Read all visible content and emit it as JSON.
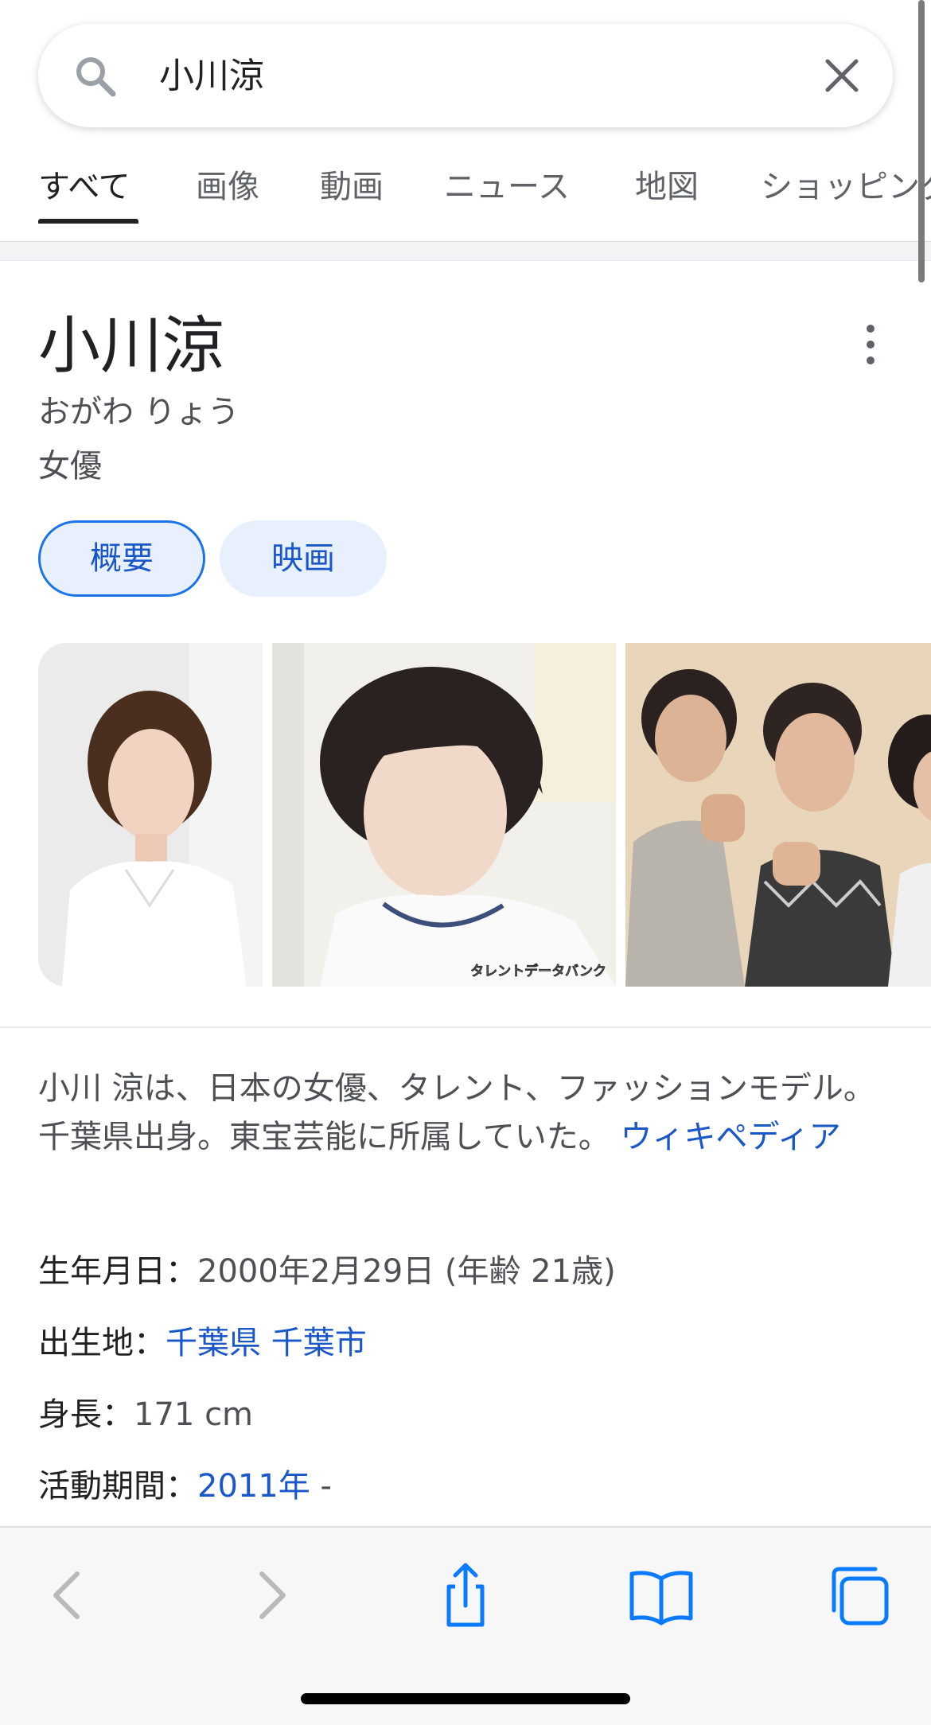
{
  "search": {
    "query": "小川涼"
  },
  "tabs": [
    {
      "label": "すべて"
    },
    {
      "label": "画像"
    },
    {
      "label": "動画"
    },
    {
      "label": "ニュース"
    },
    {
      "label": "地図"
    },
    {
      "label": "ショッピング"
    }
  ],
  "panel": {
    "title": "小川涼",
    "reading": "おがわ りょう",
    "type": "女優",
    "chips": [
      {
        "label": "概要"
      },
      {
        "label": "映画"
      }
    ],
    "image_watermark": "タレントデータバンク",
    "description": "小川 涼は、日本の女優、タレント、ファッションモデル。千葉県出身。東宝芸能に所属していた。",
    "source_link": "ウィキペディア",
    "facts": {
      "birth_label": "生年月日：",
      "birth_value": "2000年2月29日 (年齢 21歳)",
      "birthplace_label": "出生地：",
      "birthplace_pref": "千葉県",
      "birthplace_city": "千葉市",
      "height_label": "身長：",
      "height_value": "171 cm",
      "active_label": "活動期間：",
      "active_value": "2011年",
      "active_suffix": " -"
    }
  },
  "colors": {
    "link": "#1a57c8",
    "chip_bg": "#e8f0fe",
    "chip_border": "#1a73e8",
    "ios_blue": "#0a7aff"
  },
  "toolbar": {
    "icons": [
      "back-icon",
      "forward-icon",
      "share-icon",
      "bookmarks-icon",
      "tabs-icon"
    ]
  }
}
